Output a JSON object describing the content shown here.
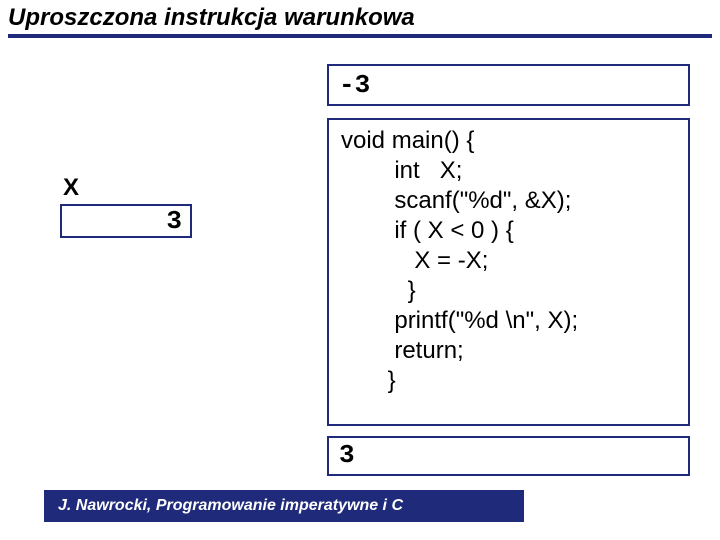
{
  "title": "Uproszczona instrukcja warunkowa",
  "input_value": "-3",
  "variable": {
    "label": "X",
    "value": "3"
  },
  "code": "void main() {\n        int   X;\n        scanf(\"%d\", &X);\n        if ( X < 0 ) {\n           X = -X;\n          }\n        printf(\"%d \\n\", X);\n        return;\n       }",
  "output_value": "3",
  "footer": "J. Nawrocki, Programowanie imperatywne i C"
}
